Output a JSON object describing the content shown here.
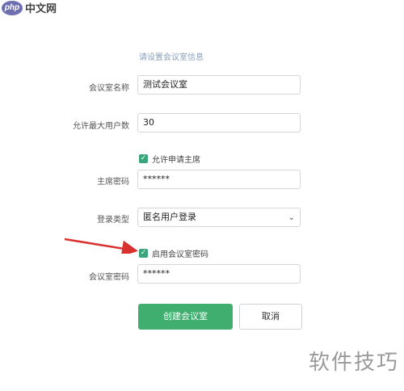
{
  "watermark": {
    "logo_text": "php",
    "site_text": "中文网",
    "corner_text": "软件技巧"
  },
  "form": {
    "subtitle": "请设置会议室信息",
    "room_name": {
      "label": "会议室名称",
      "value": "测试会议室"
    },
    "max_users": {
      "label": "允许最大用户数",
      "value": "30"
    },
    "allow_host": {
      "label": "允许申请主席",
      "checked": true
    },
    "host_password": {
      "label": "主席密码",
      "value": "******"
    },
    "login_type": {
      "label": "登录类型",
      "value": "匿名用户登录"
    },
    "enable_room_password": {
      "label": "启用会议室密码",
      "checked": true
    },
    "room_password": {
      "label": "会议室密码",
      "value": "******"
    }
  },
  "buttons": {
    "create": "创建会议室",
    "cancel": "取消"
  },
  "colors": {
    "accent": "#3fae6f",
    "arrow": "#d9322e"
  }
}
